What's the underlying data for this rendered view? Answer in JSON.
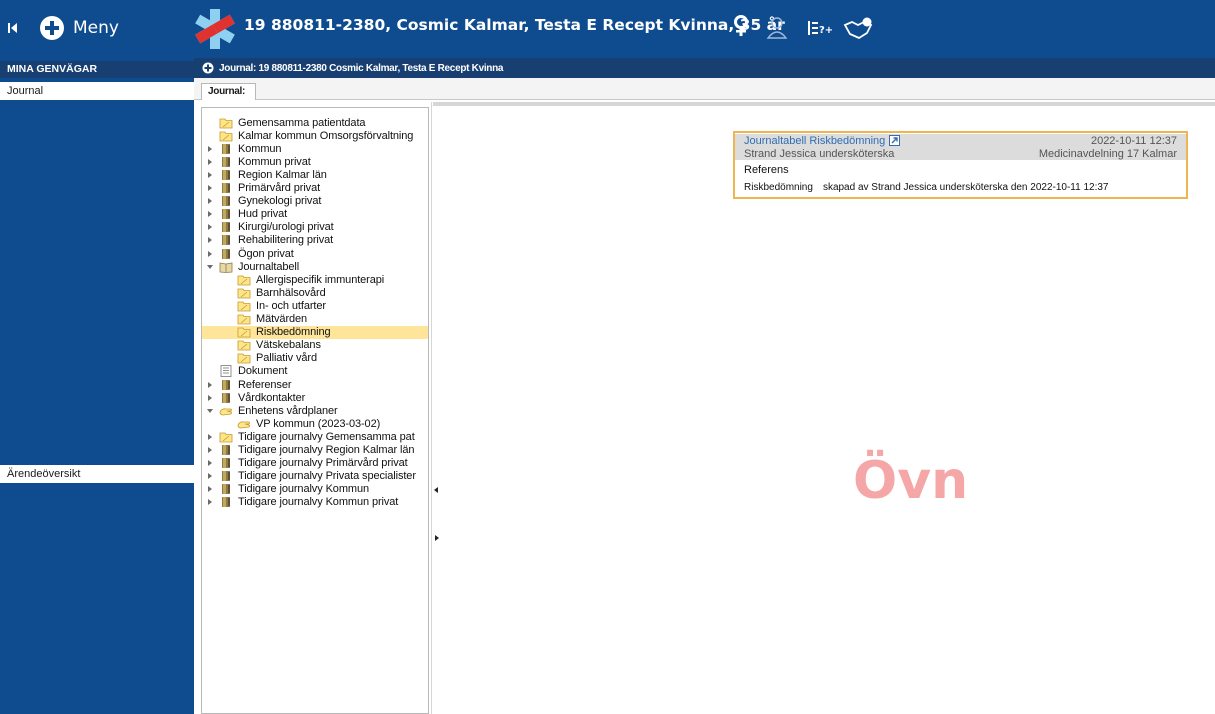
{
  "header": {
    "menu_label": "Meny",
    "patient_title": "19 880811-2380,  Cosmic Kalmar, Testa E Recept Kvinna,  35 år"
  },
  "sidebar": {
    "header": "MINA GENVÄGAR",
    "items": [
      {
        "label": "Journal"
      },
      {
        "label": "Ärendeöversikt"
      }
    ]
  },
  "breadcrumb": {
    "text": "Journal: 19 880811-2380 Cosmic Kalmar, Testa E Recept Kvinna"
  },
  "tabs": [
    {
      "label": "Journal:"
    }
  ],
  "tree": [
    {
      "label": "Gemensamma patientdata",
      "icon": "folder-note-icon",
      "expander": "none",
      "indent": 0
    },
    {
      "label": "Kalmar kommun Omsorgsförvaltning",
      "icon": "folder-note-icon",
      "expander": "none",
      "indent": 0
    },
    {
      "label": "Kommun",
      "icon": "book-icon",
      "expander": "collapsed",
      "indent": 0
    },
    {
      "label": "Kommun privat",
      "icon": "book-icon",
      "expander": "collapsed",
      "indent": 0
    },
    {
      "label": "Region Kalmar län",
      "icon": "book-icon",
      "expander": "collapsed",
      "indent": 0
    },
    {
      "label": "Primärvård privat",
      "icon": "book-icon",
      "expander": "collapsed",
      "indent": 0
    },
    {
      "label": "Gynekologi privat",
      "icon": "book-icon",
      "expander": "collapsed",
      "indent": 0
    },
    {
      "label": "Hud privat",
      "icon": "book-icon",
      "expander": "collapsed",
      "indent": 0
    },
    {
      "label": "Kirurgi/urologi privat",
      "icon": "book-icon",
      "expander": "collapsed",
      "indent": 0
    },
    {
      "label": "Rehabilitering privat",
      "icon": "book-icon",
      "expander": "collapsed",
      "indent": 0
    },
    {
      "label": "Ögon privat",
      "icon": "book-icon",
      "expander": "collapsed",
      "indent": 0
    },
    {
      "label": "Journaltabell",
      "icon": "book-open-icon",
      "expander": "expanded",
      "indent": 0
    },
    {
      "label": "Allergispecifik immunterapi",
      "icon": "folder-note-icon",
      "expander": "none",
      "indent": 1
    },
    {
      "label": "Barnhälsovård",
      "icon": "folder-note-icon",
      "expander": "none",
      "indent": 1
    },
    {
      "label": "In- och utfarter",
      "icon": "folder-note-icon",
      "expander": "none",
      "indent": 1
    },
    {
      "label": "Mätvärden",
      "icon": "folder-note-icon",
      "expander": "none",
      "indent": 1
    },
    {
      "label": "Riskbedömning",
      "icon": "folder-note-icon",
      "expander": "none",
      "indent": 1,
      "selected": true
    },
    {
      "label": "Vätskebalans",
      "icon": "folder-note-icon",
      "expander": "none",
      "indent": 1
    },
    {
      "label": "Palliativ vård",
      "icon": "folder-note-icon",
      "expander": "none",
      "indent": 1
    },
    {
      "label": "Dokument",
      "icon": "document-icon",
      "expander": "none",
      "indent": 0
    },
    {
      "label": "Referenser",
      "icon": "book-icon",
      "expander": "collapsed",
      "indent": 0
    },
    {
      "label": "Vårdkontakter",
      "icon": "book-icon",
      "expander": "collapsed",
      "indent": 0
    },
    {
      "label": "Enhetens vårdplaner",
      "icon": "hand-icon",
      "expander": "expanded",
      "indent": 0
    },
    {
      "label": "VP kommun (2023-03-02)",
      "icon": "hand-icon",
      "expander": "none",
      "indent": 1
    },
    {
      "label": "Tidigare journalvy Gemensamma pat",
      "icon": "folder-note-icon",
      "expander": "collapsed",
      "indent": 0
    },
    {
      "label": "Tidigare journalvy Region Kalmar län",
      "icon": "book-icon",
      "expander": "collapsed",
      "indent": 0
    },
    {
      "label": "Tidigare journalvy Primärvård privat",
      "icon": "book-icon",
      "expander": "collapsed",
      "indent": 0
    },
    {
      "label": "Tidigare journalvy Privata specialister",
      "icon": "book-icon",
      "expander": "collapsed",
      "indent": 0
    },
    {
      "label": "Tidigare journalvy Kommun",
      "icon": "book-icon",
      "expander": "collapsed",
      "indent": 0
    },
    {
      "label": "Tidigare journalvy Kommun privat",
      "icon": "book-icon",
      "expander": "collapsed",
      "indent": 0
    }
  ],
  "card": {
    "title": "Journaltabell Riskbedömning",
    "date": "2022-10-11 12:37",
    "author": "Strand Jessica undersköterska",
    "unit": "Medicinavdelning 17 Kalmar",
    "section": "Referens",
    "entry_term": "Riskbedömning",
    "entry_text": "skapad av Strand Jessica undersköterska den 2022-10-11 12:37"
  },
  "watermark": "Övn",
  "colors": {
    "topbar": "#0f4c8f",
    "bar_dark": "#173f72",
    "selection": "#ffe59a",
    "card_border": "#f0b550",
    "watermark": "#f5a7a7"
  }
}
